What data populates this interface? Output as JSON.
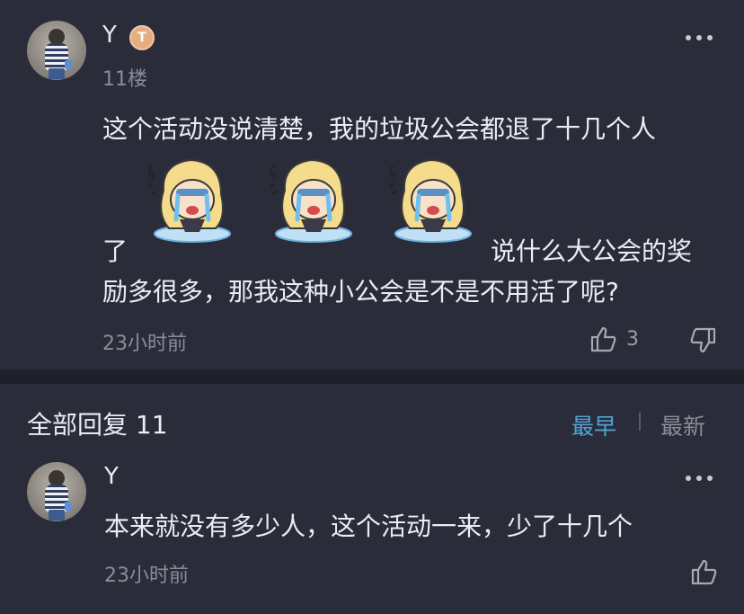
{
  "post": {
    "username": "Y",
    "badge_text": "T",
    "floor": "11楼",
    "text_line1": "这个活动没说清楚，我的垃圾公会都退了十几个人",
    "text_line2_start": "了",
    "text_line2_end": "说什么大公会的奖",
    "text_line3": "励多很多，那我这种小公会是不是不用活了呢?",
    "time": "23小时前",
    "like_count": "3"
  },
  "replies": {
    "title": "全部回复 11",
    "sort_earliest": "最早",
    "sort_latest": "最新",
    "items": [
      {
        "username": "Y",
        "text": "本来就没有多少人，这个活动一来，少了十几个",
        "time": "23小时前"
      }
    ]
  },
  "colors": {
    "background": "#2b2c3a",
    "divider": "#1f2029",
    "accent": "#4ea4d4",
    "muted_text": "#8b8c99"
  },
  "icons": [
    "avatar",
    "badge-icon",
    "more-icon",
    "crying-sticker",
    "thumbs-up-icon",
    "thumbs-down-icon"
  ]
}
